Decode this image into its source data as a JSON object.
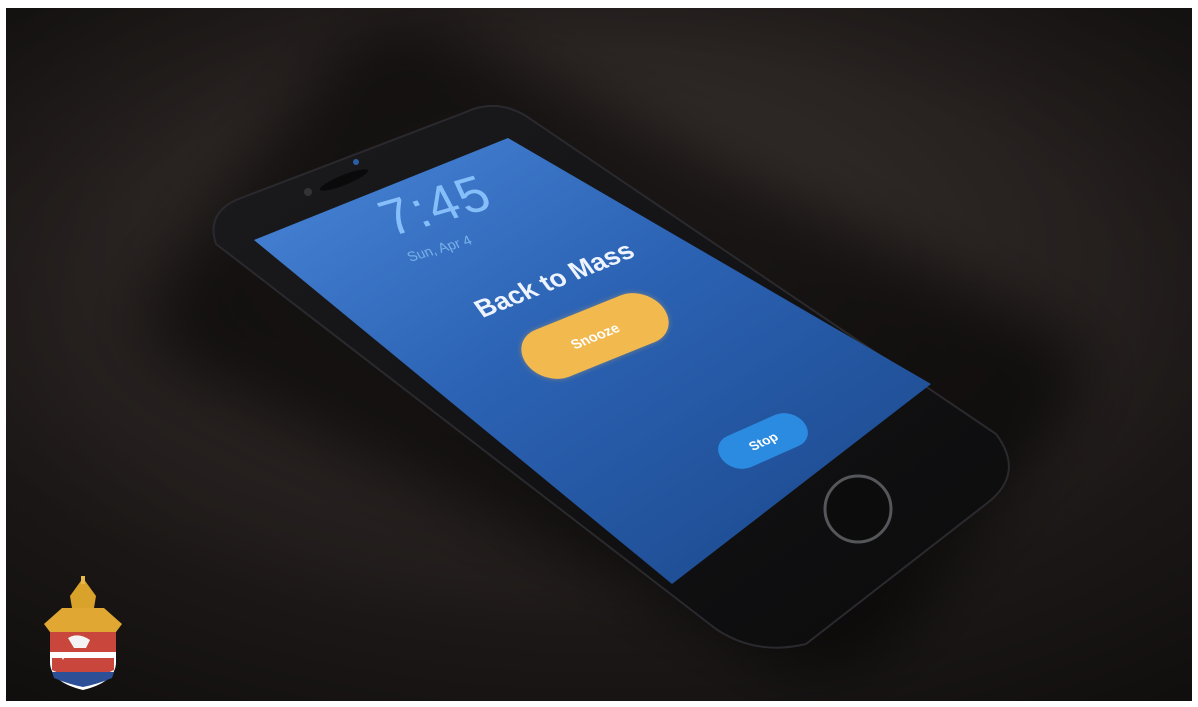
{
  "lock_screen": {
    "time": "7:45",
    "date": "Sun, Apr 4"
  },
  "alarm": {
    "title": "Back to Mass",
    "snooze_label": "Snooze",
    "stop_label": "Stop"
  },
  "colors": {
    "screen_top": "#3a6fc4",
    "screen_bottom": "#1a4b8f",
    "snooze": "#f2b94e",
    "stop": "#2a8be0"
  },
  "logo": {
    "icon": "diocese-coat-of-arms"
  }
}
